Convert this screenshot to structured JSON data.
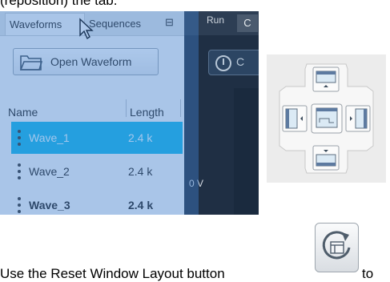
{
  "caption_top": "(reposition) the tab.",
  "panel": {
    "tabs": [
      "Waveforms",
      "Sequences"
    ],
    "pin_icon": "pin-icon",
    "open_button": "Open Waveform",
    "columns": [
      "Name",
      "Length"
    ],
    "rows": [
      {
        "name": "Wave_1",
        "length": "2.4 k",
        "selected": true,
        "bold": false
      },
      {
        "name": "Wave_2",
        "length": "2.4 k",
        "selected": false,
        "bold": false
      },
      {
        "name": "Wave_3",
        "length": "2.4 k",
        "selected": false,
        "bold": true
      }
    ]
  },
  "right_area": {
    "toolbar_label": "Run",
    "toolbar_box": "C",
    "control_letter": "C",
    "voltage_label": "0 V"
  },
  "sentence": {
    "before": "Use the Reset Window Layout button",
    "after": "to"
  },
  "colors": {
    "selection": "#12b6e8",
    "drag_overlay": "#4080d2",
    "dark_panel": "#1f2f44"
  }
}
